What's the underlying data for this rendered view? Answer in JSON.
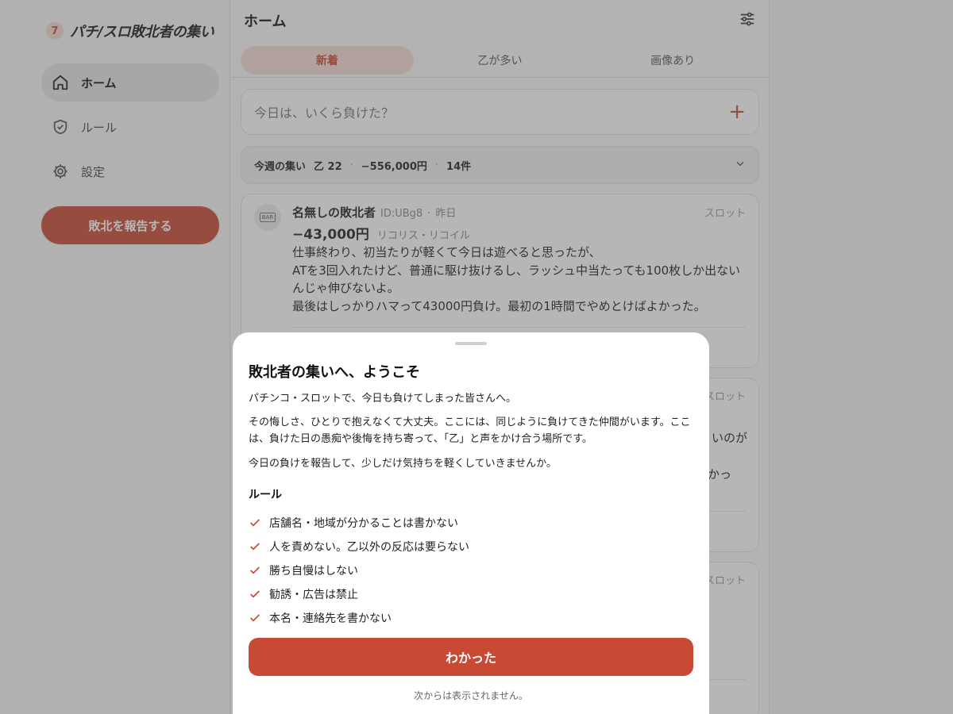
{
  "brand": {
    "logo": "7",
    "title": "パチ/スロ敗北者の集い"
  },
  "sidebar": {
    "items": [
      {
        "label": "ホーム",
        "icon": "home-icon",
        "active": true
      },
      {
        "label": "ルール",
        "icon": "shield-check-icon",
        "active": false
      },
      {
        "label": "設定",
        "icon": "gear-icon",
        "active": false
      }
    ],
    "report_button": "敗北を報告する"
  },
  "main": {
    "title": "ホーム",
    "tabs": [
      {
        "label": "新着",
        "active": true
      },
      {
        "label": "乙が多い",
        "active": false
      },
      {
        "label": "画像あり",
        "active": false
      }
    ],
    "compose_placeholder": "今日は、いくら負けた？",
    "summary": {
      "label": "今週の集い",
      "otsu": "乙 22",
      "total": "−556,000円",
      "count": "14件"
    },
    "posts": [
      {
        "name": "名無しの敗北者",
        "id": "ID:UBg8",
        "time": "昨日",
        "category": "スロット",
        "amount": "−43,000円",
        "machine": "リコリス・リコイル",
        "body": [
          "仕事終わり、初当たりが軽くて今日は遊べると思ったが、",
          "ATを3回入れたけど、普通に駆け抜けるし、ラッシュ中当たっても100枚しか出ないんじゃ伸びないよ。",
          "最後はしっかりハマって43000円負け。最初の1時間でやめとけばよかった。"
        ]
      },
      {
        "category": "スロット",
        "fragments": [
          "いのが",
          "かっ"
        ]
      },
      {
        "category": "スロット"
      }
    ]
  },
  "modal": {
    "title": "敗北者の集いへ、ようこそ",
    "paragraphs": [
      "パチンコ・スロットで、今日も負けてしまった皆さんへ。",
      "その悔しさ、ひとりで抱えなくて大丈夫。ここには、同じように負けてきた仲間がいます。ここは、負けた日の愚痴や後悔を持ち寄って、「乙」と声をかけ合う場所です。",
      "今日の負けを報告して、少しだけ気持ちを軽くしていきませんか。"
    ],
    "rules_heading": "ルール",
    "rules": [
      "店舗名・地域が分かることは書かない",
      "人を責めない。乙以外の反応は要らない",
      "勝ち自慢はしない",
      "勧誘・広告は禁止",
      "本名・連絡先を書かない"
    ],
    "ok_button": "わかった",
    "note": "次からは表示されません。"
  },
  "colors": {
    "accent": "#c94a34",
    "accent_soft": "#f8ddd6"
  }
}
